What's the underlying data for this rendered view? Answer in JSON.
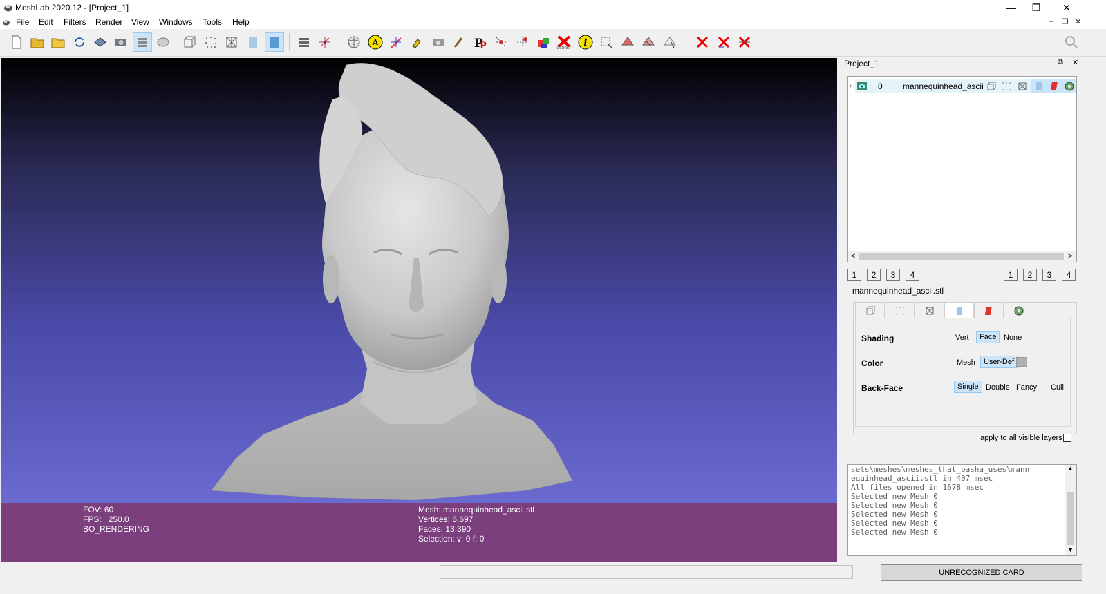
{
  "window": {
    "title": "MeshLab 2020.12 - [Project_1]",
    "minimize_glyph": "—",
    "restore_glyph": "❐",
    "close_glyph": "✕"
  },
  "menu": {
    "items": [
      "File",
      "Edit",
      "Filters",
      "Render",
      "View",
      "Windows",
      "Tools",
      "Help"
    ],
    "mdi_controls": [
      "–",
      "❐",
      "✕"
    ]
  },
  "toolbar": {
    "icons": [
      "new-project-icon",
      "open-project-icon",
      "import-mesh-icon",
      "reload-icon",
      "save-icon",
      "snapshot-icon",
      "layers-icon",
      "sphere-icon",
      "bbox-icon",
      "points-icon",
      "wireframe-icon",
      "flat-icon",
      "smooth-icon",
      "plugin-layers-icon",
      "axes-icon",
      "trackball-icon",
      "annotation-icon",
      "measure-icon",
      "paint-icon",
      "camera-icon",
      "brush-icon",
      "pp-icon",
      "select-vertices-icon",
      "select-connected-icon",
      "color-fill-icon",
      "georef-icon",
      "info-icon",
      "select-box-icon",
      "select-faces-icon",
      "select-edges-icon",
      "select-cursor-icon",
      "delete-vertices-icon",
      "delete-faces-icon",
      "delete-all-icon"
    ],
    "search_icon": "search-icon"
  },
  "viewport": {
    "info_left": [
      "FOV: 60",
      "FPS:   250.0",
      "BO_RENDERING"
    ],
    "info_right": [
      "Mesh: mannequinhead_ascii.stl",
      "Vertices: 6,697",
      "Faces: 13,390",
      "Selection: v: 0 f: 0"
    ]
  },
  "panel": {
    "title": "Project_1",
    "float_glyph": "⧉",
    "close_glyph": "✕",
    "layer": {
      "index": "0",
      "name": "mannequinhead_ascii"
    },
    "scroll_left": "<",
    "scroll_right": ">",
    "left_buttons": [
      "1",
      "2",
      "3",
      "4"
    ],
    "right_buttons": [
      "1",
      "2",
      "3",
      "4"
    ],
    "mesh_file": "mannequinhead_ascii.stl",
    "render_options": {
      "shading_label": "Shading",
      "shading_opts": [
        "Vert",
        "Face",
        "None"
      ],
      "shading_selected": "Face",
      "color_label": "Color",
      "color_opts": [
        "Mesh",
        "User-Def"
      ],
      "color_selected": "User-Def",
      "backface_label": "Back-Face",
      "backface_opts": [
        "Single",
        "Double",
        "Fancy",
        "Cull"
      ],
      "backface_selected": "Single",
      "apply_all": "apply to all visible layers"
    },
    "log": [
      "sets\\meshes\\meshes_that_pasha_uses\\mann",
      "equinhead_ascii.stl in 407 msec",
      "All files opened in 1678 msec",
      "Selected new Mesh 0",
      "Selected new Mesh 0",
      "Selected new Mesh 0",
      "Selected new Mesh 0",
      "Selected new Mesh 0"
    ]
  },
  "status": {
    "card": "UNRECOGNIZED CARD"
  },
  "colors": {
    "infobar": "#7b3f7d",
    "selection": "#cce4f7"
  }
}
